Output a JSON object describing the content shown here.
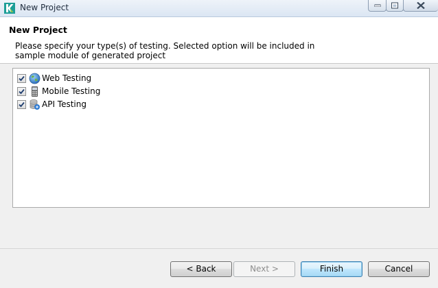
{
  "window": {
    "title": "New Project",
    "icon": "katalon-k-icon",
    "controls": [
      "minimize-icon",
      "maximize-icon",
      "close-icon"
    ]
  },
  "header": {
    "title": "New Project",
    "description": "Please specify your type(s) of testing. Selected option will be included in sample module of generated project"
  },
  "options": [
    {
      "label": "Web Testing",
      "checked": true,
      "icon": "globe-icon"
    },
    {
      "label": "Mobile Testing",
      "checked": true,
      "icon": "mobile-device-icon"
    },
    {
      "label": "API Testing",
      "checked": true,
      "icon": "api-database-icon"
    }
  ],
  "buttons": {
    "back": "< Back",
    "next": "Next >",
    "finish": "Finish",
    "cancel": "Cancel"
  },
  "colors": {
    "accent": "#3c7fb1",
    "check": "#1e3d6e"
  }
}
